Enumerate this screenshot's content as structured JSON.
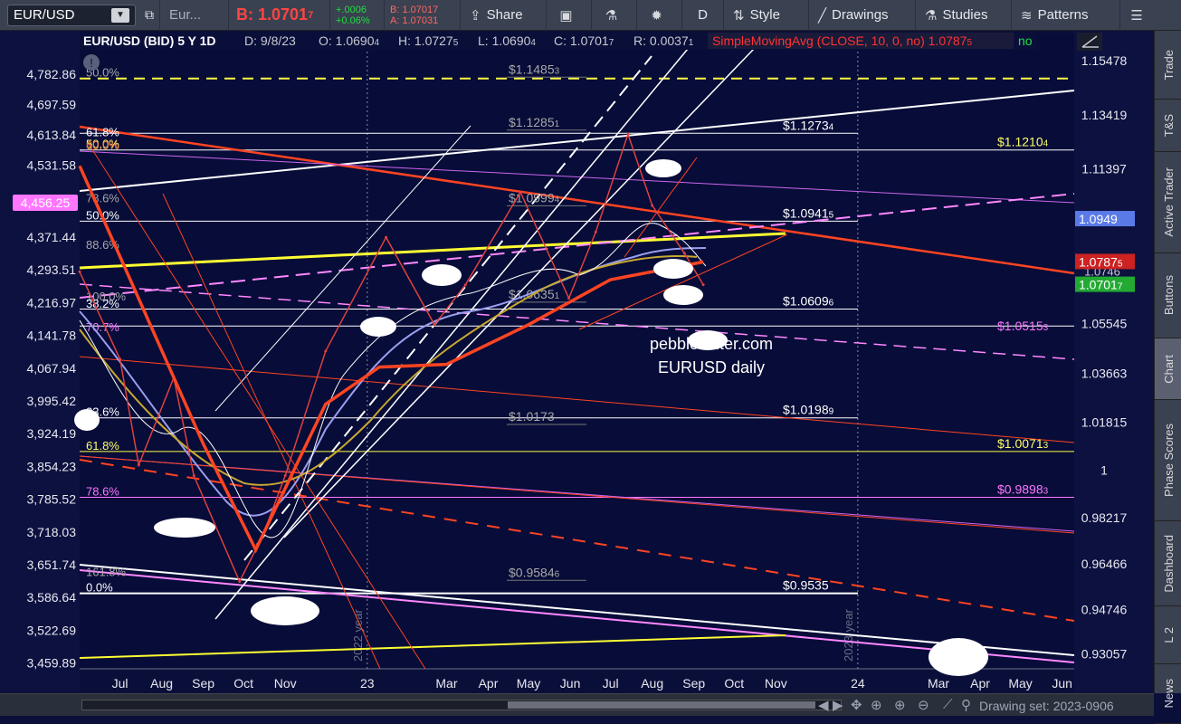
{
  "toolbar": {
    "symbol": "EUR/USD",
    "symbol_tab": "Eur...",
    "bid_label": "B: 1.0701",
    "bid_sup": "7",
    "change_abs": "+.0006",
    "change_pct": "+0.06%",
    "bid_small": "B: 1.07017",
    "ask_small": "A: 1.07031",
    "share": "Share",
    "period": "D",
    "style": "Style",
    "drawings": "Drawings",
    "studies": "Studies",
    "patterns": "Patterns"
  },
  "sidebar": [
    "Trade",
    "T&S",
    "Active Trader",
    "Buttons",
    "Chart",
    "Phase Scores",
    "Dashboard",
    "L 2",
    "News"
  ],
  "header": {
    "title": "EUR/USD (BID) 5 Y 1D",
    "date": "D: 9/8/23",
    "open": "O: 1.0690",
    "open_sup": "4",
    "high": "H: 1.0727",
    "high_sup": "5",
    "low": "L: 1.0690",
    "low_sup": "4",
    "close": "C: 1.0701",
    "close_sup": "7",
    "range": "R: 0.0037",
    "range_sup": "1",
    "study": "SimpleMovingAvg (CLOSE, 10, 0, no)",
    "study_val": "1.0787",
    "study_sup": "5",
    "study_no": "no"
  },
  "bottom": {
    "drawing_set": "Drawing set: 2023-0906"
  },
  "chart_data": {
    "type": "line",
    "title": "EUR/USD (BID) 5 Y 1D",
    "watermark": [
      "pebblewriter.com",
      "EURUSD daily"
    ],
    "x_ticks": [
      "Jul",
      "Aug",
      "Sep",
      "Oct",
      "Nov",
      "23",
      "Mar",
      "Apr",
      "May",
      "Jun",
      "Jul",
      "Aug",
      "Sep",
      "Oct",
      "Nov",
      "24",
      "Mar",
      "Apr",
      "May",
      "Jun"
    ],
    "left_ticks": [
      "4,782.86",
      "4,697.59",
      "4,613.84",
      "4,531.58",
      "4,371.44",
      "4,293.51",
      "4,216.97",
      "4,141.78",
      "4,067.94",
      "3,995.42",
      "3,924.19",
      "3,854.23",
      "3,785.52",
      "3,718.03",
      "3,651.74",
      "3,586.64",
      "3,522.69",
      "3,459.89"
    ],
    "left_marker": "4,456.25",
    "right_ticks": [
      "1.15478",
      "1.13419",
      "1.11397",
      "1.05545",
      "1.03663",
      "1.01815",
      "1",
      "0.98217",
      "0.96466",
      "0.94746",
      "0.93057"
    ],
    "price_markers": [
      {
        "value": "1.0949",
        "color": "#5a7ae8"
      },
      {
        "value": "1.0787",
        "sup": "5",
        "color": "#cc2222"
      },
      {
        "value": "1.0701",
        "sup": "7",
        "color": "#22aa33"
      }
    ],
    "hidden_tick": "1.0746",
    "fib_labels_left": [
      {
        "text": "50.0%",
        "color": "#a8a8a8",
        "y": 1.148
      },
      {
        "text": "61.8%",
        "color": "#ffffff",
        "y": 1.1255
      },
      {
        "text": "50.0%",
        "color": "#ffff66",
        "y": 1.121
      },
      {
        "text": "60.0%",
        "color": "#ff7744",
        "y": 1.1205
      },
      {
        "text": "78.6%",
        "color": "#a8a8a8",
        "y": 1.1005
      },
      {
        "text": "50.0%",
        "color": "#ffffff",
        "y": 1.094
      },
      {
        "text": "88.6%",
        "color": "#a8a8a8",
        "y": 1.083
      },
      {
        "text": "100.0%",
        "color": "#a8a8a8",
        "y": 1.0635
      },
      {
        "text": "38.2%",
        "color": "#ffffff",
        "y": 1.0608
      },
      {
        "text": "70.7%",
        "color": "#ff77ff",
        "y": 1.0518
      },
      {
        "text": "23.6%",
        "color": "#ffffff",
        "y": 1.0198
      },
      {
        "text": "61.8%",
        "color": "#ffff66",
        "y": 1.0071
      },
      {
        "text": "78.6%",
        "color": "#ff77ff",
        "y": 0.9898
      },
      {
        "text": "161.8%",
        "color": "#a8a8a8",
        "y": 0.9593
      },
      {
        "text": "0.0%",
        "color": "#ffffff",
        "y": 0.9535
      }
    ],
    "price_labels": [
      {
        "text": "$1.1485",
        "sup": "3",
        "color": "#a8a8a8",
        "y": 1.1485
      },
      {
        "text": "$1.1285",
        "sup": "1",
        "color": "#a8a8a8",
        "y": 1.1285
      },
      {
        "text": "$1.1273",
        "sup": "4",
        "color": "#ffffff",
        "y": 1.1273
      },
      {
        "text": "$1.1210",
        "sup": "4",
        "color": "#ffff66",
        "y": 1.121
      },
      {
        "text": "$1.0999",
        "sup": "4",
        "color": "#a8a8a8",
        "y": 1.0999
      },
      {
        "text": "$1.0941",
        "sup": "5",
        "color": "#ffffff",
        "y": 1.0941
      },
      {
        "text": "$1.0635",
        "sup": "1",
        "color": "#a8a8a8",
        "y": 1.0635
      },
      {
        "text": "$1.0609",
        "sup": "6",
        "color": "#ffffff",
        "y": 1.0609
      },
      {
        "text": "$1.0515",
        "sup": "3",
        "color": "#ff77ff",
        "y": 1.0515
      },
      {
        "text": "$1.0198",
        "sup": "9",
        "color": "#ffffff",
        "y": 1.0198
      },
      {
        "text": "$1.0173",
        "color": "#a8a8a8",
        "y": 1.0173
      },
      {
        "text": "$1.0071",
        "sup": "3",
        "color": "#ffff66",
        "y": 1.0071
      },
      {
        "text": "$0.9898",
        "sup": "3",
        "color": "#ff77ff",
        "y": 0.9898
      },
      {
        "text": "$0.9584",
        "sup": "6",
        "color": "#a8a8a8",
        "y": 0.9584
      },
      {
        "text": "$0.9535",
        "color": "#ffffff",
        "y": 0.9535
      }
    ],
    "year_labels": [
      "2022 year",
      "2023 year"
    ],
    "series": [
      {
        "name": "EUR/USD",
        "color": "#e04040",
        "x": [
          "2022-06-01",
          "2022-07-01",
          "2022-07-15",
          "2022-08-10",
          "2022-08-25",
          "2022-09-28",
          "2022-10-15",
          "2022-11-01",
          "2022-12-01",
          "2023-01-15",
          "2023-02-20",
          "2023-03-15",
          "2023-04-25",
          "2023-05-31",
          "2023-06-20",
          "2023-07-14",
          "2023-08-01",
          "2023-08-25",
          "2023-09-08"
        ],
        "y": [
          1.075,
          1.042,
          1.002,
          1.035,
          0.998,
          0.958,
          0.975,
          0.998,
          1.045,
          1.088,
          1.055,
          1.07,
          1.105,
          1.065,
          1.09,
          1.127,
          1.1,
          1.082,
          1.0701
        ]
      },
      {
        "name": "SimpleMovingAvg (CLOSE, 10, 0, no)",
        "color": "#ff4422",
        "x": [
          "2022-06-01",
          "2022-09-01",
          "2022-10-10",
          "2022-12-01",
          "2023-01-10",
          "2023-03-01",
          "2023-05-01",
          "2023-07-01",
          "2023-09-08"
        ],
        "y": [
          1.115,
          1.01,
          0.97,
          1.025,
          1.039,
          1.04,
          1.055,
          1.072,
          1.0787
        ]
      }
    ],
    "ylim": [
      0.925,
      1.165
    ],
    "xlim": [
      "2022-06-01",
      "2024-06-10"
    ]
  }
}
